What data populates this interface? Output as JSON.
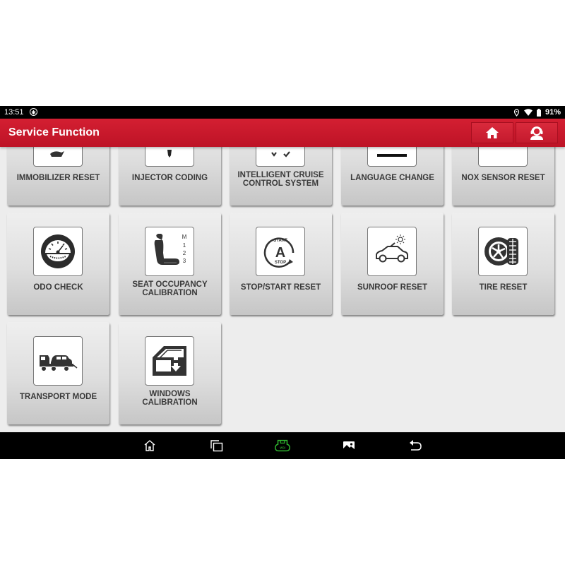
{
  "status_bar": {
    "time": "13:51",
    "left_icons": [
      "bluetooth-icon"
    ],
    "right_icons": [
      "location-icon",
      "wifi-icon",
      "battery-icon"
    ],
    "battery": "91%"
  },
  "app_bar": {
    "title": "Service Function",
    "buttons": [
      {
        "name": "home-button",
        "icon": "home-icon"
      },
      {
        "name": "support-button",
        "icon": "headset-agent-icon"
      }
    ],
    "color": "#c8192c"
  },
  "tiles": [
    {
      "label": "IMMOBILIZER RESET",
      "icon": "immobilizer-key-icon"
    },
    {
      "label": "INJECTOR CODING",
      "icon": "injector-icon"
    },
    {
      "label": "INTELLIGENT CRUISE CONTROL SYSTEM",
      "icon": "cruise-control-icon"
    },
    {
      "label": "LANGUAGE CHANGE",
      "icon": "language-icon"
    },
    {
      "label": "NOX SENSOR RESET",
      "icon": "nox-sensor-icon"
    },
    {
      "label": "ODO CHECK",
      "icon": "odometer-gauge-icon"
    },
    {
      "label": "SEAT OCCUPANCY CALIBRATION",
      "icon": "seat-icon",
      "icon_text": [
        "M",
        "1",
        "2",
        "3"
      ]
    },
    {
      "label": "STOP/START RESET",
      "icon": "stop-start-icon",
      "icon_text": [
        "START",
        "A",
        "STOP"
      ]
    },
    {
      "label": "SUNROOF RESET",
      "icon": "sunroof-car-icon"
    },
    {
      "label": "TIRE RESET",
      "icon": "tire-icon"
    },
    {
      "label": "TRANSPORT MODE",
      "icon": "tow-truck-icon"
    },
    {
      "label": "WINDOWS CALIBRATION",
      "icon": "window-updown-icon"
    }
  ],
  "nav_bar": {
    "items": [
      {
        "name": "home",
        "icon": "home-outline-icon"
      },
      {
        "name": "recents",
        "icon": "recents-icon"
      },
      {
        "name": "vci",
        "icon": "vci-icon",
        "label": "VCI",
        "color": "#2fb52f"
      },
      {
        "name": "screenshot",
        "icon": "gallery-icon"
      },
      {
        "name": "back",
        "icon": "back-icon"
      }
    ]
  }
}
